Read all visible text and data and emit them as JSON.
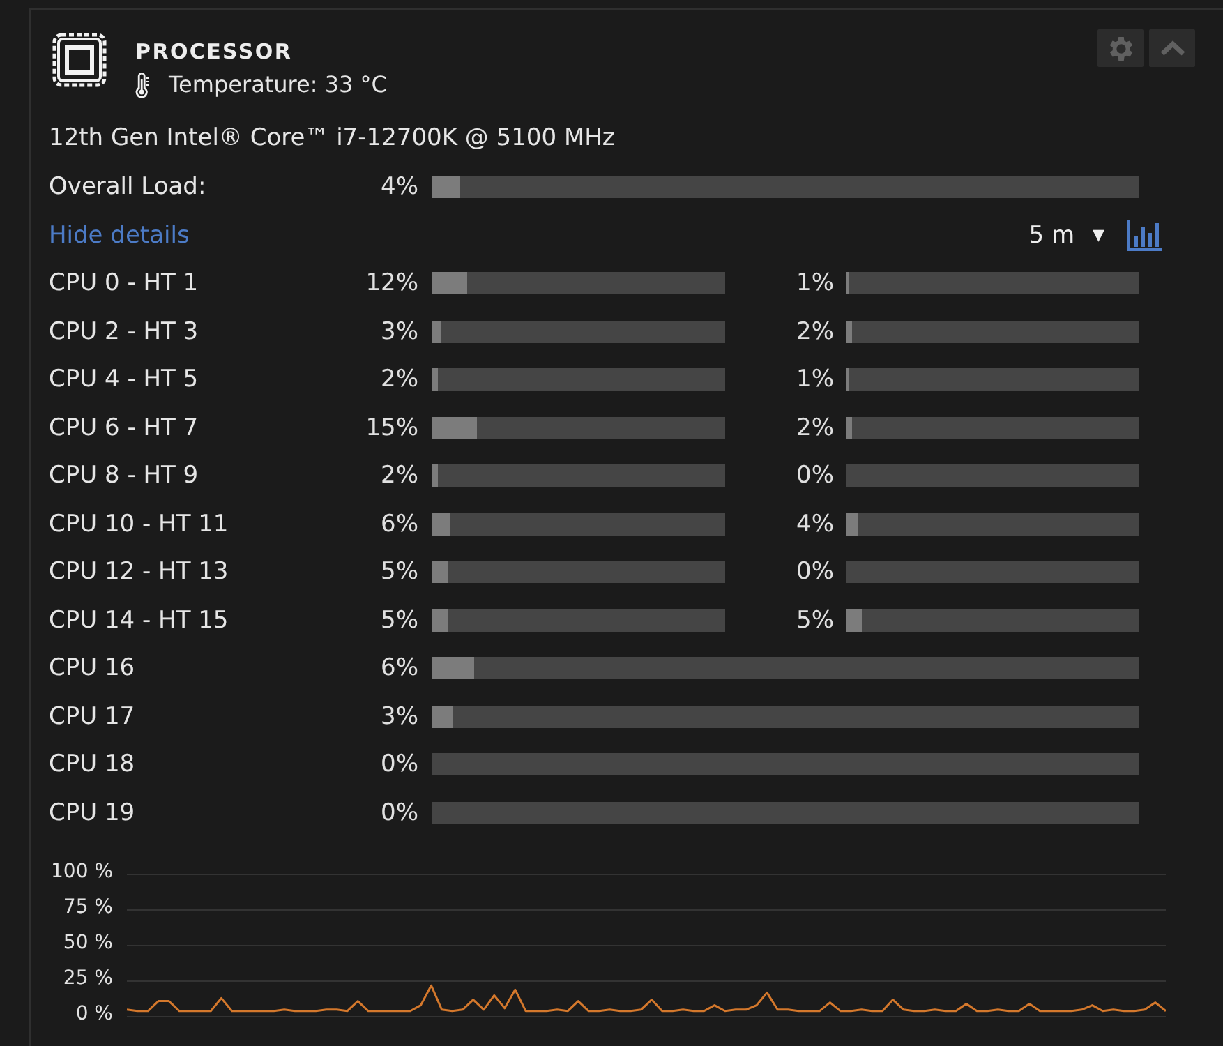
{
  "header": {
    "title": "PROCESSOR",
    "temperature": "Temperature: 33 °C"
  },
  "model": "12th Gen Intel® Core™ i7-12700K @ 5100 MHz",
  "overall": {
    "label": "Overall Load:",
    "reading": "4%",
    "level": 0.04
  },
  "details_link": "Hide details",
  "range": {
    "value": "5 m",
    "arrow": "▼"
  },
  "cores": [
    {
      "label": "CPU 0 - HT 1",
      "threads": [
        {
          "reading": "12%",
          "level": 0.12
        },
        {
          "reading": "1%",
          "level": 0.01
        }
      ]
    },
    {
      "label": "CPU 2 - HT 3",
      "threads": [
        {
          "reading": "3%",
          "level": 0.03
        },
        {
          "reading": "2%",
          "level": 0.02
        }
      ]
    },
    {
      "label": "CPU 4 - HT 5",
      "threads": [
        {
          "reading": "2%",
          "level": 0.02
        },
        {
          "reading": "1%",
          "level": 0.01
        }
      ]
    },
    {
      "label": "CPU 6 - HT 7",
      "threads": [
        {
          "reading": "15%",
          "level": 0.15
        },
        {
          "reading": "2%",
          "level": 0.02
        }
      ]
    },
    {
      "label": "CPU 8 - HT 9",
      "threads": [
        {
          "reading": "2%",
          "level": 0.02
        },
        {
          "reading": "0%"
        }
      ]
    },
    {
      "label": "CPU 10 - HT 11",
      "threads": [
        {
          "reading": "6%",
          "level": 0.06
        },
        {
          "reading": "4%",
          "level": 0.04
        }
      ]
    },
    {
      "label": "CPU 12 - HT 13",
      "threads": [
        {
          "reading": "5%",
          "level": 0.05
        },
        {
          "reading": "0%"
        }
      ]
    },
    {
      "label": "CPU 14 - HT 15",
      "threads": [
        {
          "reading": "5%",
          "level": 0.05
        },
        {
          "reading": "5%",
          "level": 0.05
        }
      ]
    },
    {
      "label": "CPU 16",
      "threads": [
        {
          "reading": "6%",
          "level": 0.06
        }
      ]
    },
    {
      "label": "CPU 17",
      "threads": [
        {
          "reading": "3%",
          "level": 0.03
        }
      ]
    },
    {
      "label": "CPU 18",
      "threads": [
        {
          "reading": "0%"
        }
      ]
    },
    {
      "label": "CPU 19",
      "threads": [
        {
          "reading": "0%"
        }
      ]
    }
  ],
  "history": {
    "chart_data": {
      "type": "line",
      "grid": true,
      "ylim": [
        0,
        100
      ],
      "yticks": [
        {
          "value": 100,
          "label": "100 %"
        },
        {
          "value": 75,
          "label": "75 %"
        },
        {
          "value": 50,
          "label": "50 %"
        },
        {
          "value": 25,
          "label": "25 %"
        },
        {
          "value": 0,
          "label": "0 %"
        }
      ],
      "series": [
        {
          "color": "#d4782c",
          "values": [
            5,
            4,
            4,
            11,
            11,
            4,
            4,
            4,
            4,
            13,
            4,
            4,
            4,
            4,
            4,
            5,
            4,
            4,
            4,
            5,
            5,
            4,
            11,
            4,
            4,
            4,
            4,
            4,
            8,
            22,
            5,
            4,
            5,
            12,
            5,
            15,
            6,
            19,
            4,
            4,
            4,
            5,
            4,
            11,
            4,
            4,
            5,
            4,
            4,
            5,
            12,
            4,
            4,
            5,
            4,
            4,
            8,
            4,
            5,
            5,
            8,
            17,
            5,
            5,
            4,
            4,
            4,
            10,
            4,
            4,
            5,
            4,
            4,
            12,
            5,
            4,
            4,
            5,
            4,
            4,
            9,
            4,
            4,
            5,
            4,
            4,
            9,
            4,
            4,
            4,
            4,
            5,
            8,
            4,
            5,
            4,
            4,
            5,
            10,
            4
          ]
        }
      ]
    }
  }
}
